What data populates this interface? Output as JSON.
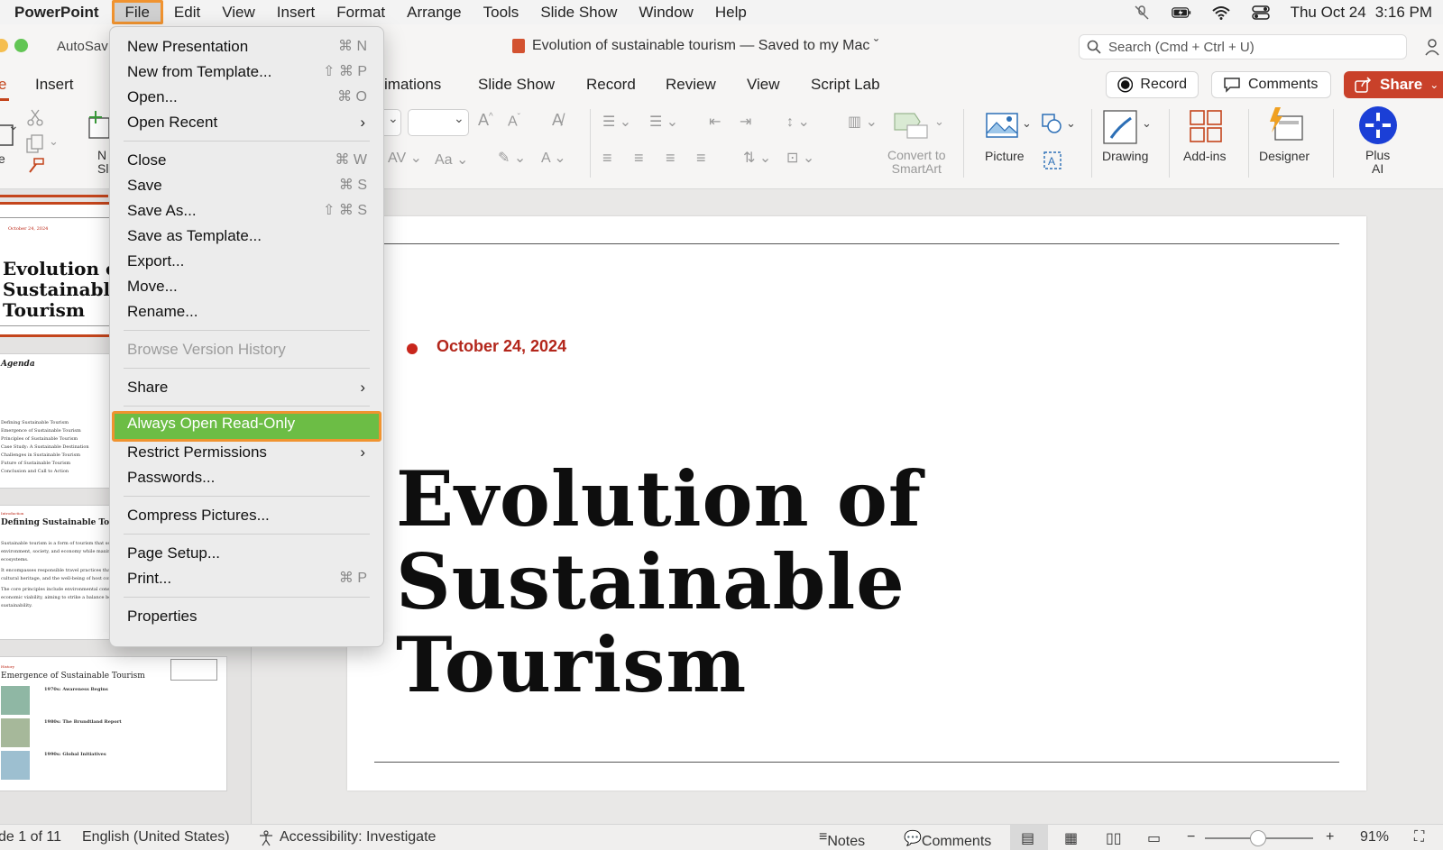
{
  "menubar": {
    "app_name": "PowerPoint",
    "items": [
      "File",
      "Edit",
      "View",
      "Insert",
      "Format",
      "Arrange",
      "Tools",
      "Slide Show",
      "Window",
      "Help"
    ],
    "date": "Thu Oct 24",
    "time": "3:16 PM"
  },
  "titlebar": {
    "autosave": "AutoSav",
    "doc_title": "Evolution of sustainable tourism — Saved to my Mac ˇ",
    "search_placeholder": "Search (Cmd + Ctrl + U)"
  },
  "ribbon_tabs": {
    "home_fragment": "e",
    "insert": "Insert",
    "animations": "imations",
    "slide_show": "Slide Show",
    "record": "Record",
    "review": "Review",
    "view": "View",
    "script_lab": "Script Lab",
    "record_btn": "Record",
    "comments_btn": "Comments",
    "share_btn": "Share"
  },
  "ribbon": {
    "new_slide_frag": "N\nSl",
    "convert_smartart": "Convert to\nSmartArt",
    "picture": "Picture",
    "drawing": "Drawing",
    "addins": "Add-ins",
    "designer": "Designer",
    "plus_ai": "Plus\nAI"
  },
  "thumbnails": {
    "slide1": {
      "date": "October 24, 2024",
      "title": "Evolution of Sustainable Tourism"
    },
    "slide2": {
      "title": "Agenda",
      "items": [
        "Defining Sustainable Tourism",
        "Emergence of Sustainable Tourism",
        "Principles of Sustainable Tourism",
        "Case Study: A Sustainable Destination",
        "Challenges in Sustainable Tourism",
        "Future of Sustainable Tourism",
        "Conclusion and Call to Action"
      ]
    },
    "slide3": {
      "kicker": "Introduction",
      "title": "Defining Sustainable Tourism",
      "p1": "Sustainable tourism is a form of tourism that seeks to minimize the negative impact on the environment, society, and economy while maximizing the benefits for local communities and ecosystems.",
      "p2": "It encompasses responsible travel practices that ensure the preservation of natural resources, cultural heritage, and the well-being of host communities.",
      "p3": "The core principles include environmental conservation, respect for local cultures, and economic viability, aiming to strike a balance between tourism development and sustainability."
    },
    "slide4": {
      "kicker": "History",
      "title": "Emergence of Sustainable Tourism",
      "rows": [
        "1970s: Awareness Begins",
        "1980s: The Brundtland Report",
        "1990s: Global Initiatives"
      ]
    }
  },
  "file_menu": {
    "items": [
      {
        "label": "New Presentation",
        "shortcut": "⌘ N"
      },
      {
        "label": "New from Template...",
        "shortcut": "⇧ ⌘ P"
      },
      {
        "label": "Open...",
        "shortcut": "⌘ O"
      },
      {
        "label": "Open Recent",
        "arrow": "›"
      },
      {
        "label": "Close",
        "shortcut": "⌘ W"
      },
      {
        "label": "Save",
        "shortcut": "⌘ S"
      },
      {
        "label": "Save As...",
        "shortcut": "⇧ ⌘ S"
      },
      {
        "label": "Save as Template..."
      },
      {
        "label": "Export..."
      },
      {
        "label": "Move..."
      },
      {
        "label": "Rename..."
      },
      {
        "label": "Browse Version History"
      },
      {
        "label": "Share",
        "arrow": "›"
      },
      {
        "label": "Always Open Read-Only"
      },
      {
        "label": "Restrict Permissions",
        "arrow": "›"
      },
      {
        "label": "Passwords..."
      },
      {
        "label": "Compress Pictures..."
      },
      {
        "label": "Page Setup..."
      },
      {
        "label": "Print...",
        "shortcut": "⌘ P"
      },
      {
        "label": "Properties"
      }
    ]
  },
  "slide": {
    "date": "October 24, 2024",
    "title_lines": [
      "Evolution of",
      "Sustainable",
      "Tourism"
    ]
  },
  "statusbar": {
    "slide_info": "de 1 of 11",
    "language": "English (United States)",
    "accessibility": "Accessibility: Investigate",
    "notes": "Notes",
    "comments": "Comments",
    "zoom": "91%"
  },
  "colors": {
    "accent": "#c4451c",
    "highlight": "#6cbd45",
    "highlight_border": "#f09330",
    "date_red": "#b3261b"
  }
}
